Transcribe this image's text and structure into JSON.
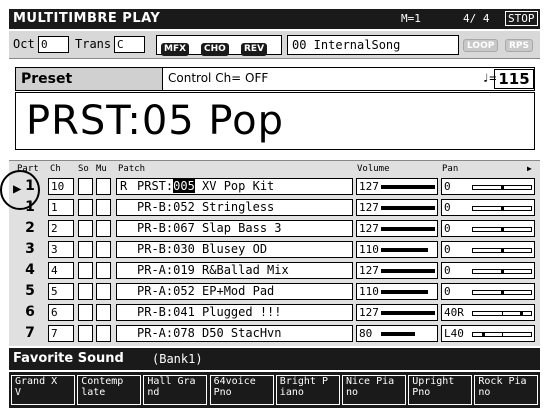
{
  "header": {
    "title": "MULTITIMBRE PLAY",
    "mode": "M=1",
    "meter": "4/ 4",
    "stop_label": "STOP"
  },
  "controls": {
    "oct_label": "Oct",
    "oct_value": "0",
    "trans_label": "Trans",
    "trans_value": "C",
    "mfx_label": "MFX",
    "cho_label": "CHO",
    "rev_label": "REV",
    "song": "00  InternalSong",
    "loop_label": "LOOP",
    "rps_label": "RPS"
  },
  "preset": {
    "label": "Preset",
    "control_ch": "Control Ch= OFF",
    "tempo_symbol": "♩=",
    "tempo": "115",
    "patch_name": "PRST:05 Pop"
  },
  "table": {
    "col_part": "Part",
    "col_ch": "Ch",
    "col_so": "So",
    "col_mu": "Mu",
    "col_patch": "Patch",
    "col_volume": "Volume",
    "col_pan": "Pan",
    "rows": [
      {
        "part": "1",
        "ch": "10",
        "rflag": "R",
        "patch_pre": "PRST:",
        "patch_sel": "005",
        "patch_post": " XV Pop Kit",
        "volume": "127",
        "volume_level": 1.0,
        "pan": "0",
        "pan_pos": 0.5
      },
      {
        "part": "1",
        "ch": "1",
        "rflag": "",
        "patch_pre": "PR-B:052 Stringless",
        "patch_sel": "",
        "patch_post": "",
        "volume": "127",
        "volume_level": 1.0,
        "pan": "0",
        "pan_pos": 0.5
      },
      {
        "part": "2",
        "ch": "2",
        "rflag": "",
        "patch_pre": "PR-B:067 Slap Bass 3",
        "patch_sel": "",
        "patch_post": "",
        "volume": "127",
        "volume_level": 1.0,
        "pan": "0",
        "pan_pos": 0.5
      },
      {
        "part": "3",
        "ch": "3",
        "rflag": "",
        "patch_pre": "PR-B:030 Blusey OD",
        "patch_sel": "",
        "patch_post": "",
        "volume": "110",
        "volume_level": 0.87,
        "pan": "0",
        "pan_pos": 0.5
      },
      {
        "part": "4",
        "ch": "4",
        "rflag": "",
        "patch_pre": "PR-A:019 R&Ballad Mix",
        "patch_sel": "",
        "patch_post": "",
        "volume": "127",
        "volume_level": 1.0,
        "pan": "0",
        "pan_pos": 0.5
      },
      {
        "part": "5",
        "ch": "5",
        "rflag": "",
        "patch_pre": "PR-A:052 EP+Mod Pad",
        "patch_sel": "",
        "patch_post": "",
        "volume": "110",
        "volume_level": 0.87,
        "pan": "0",
        "pan_pos": 0.5
      },
      {
        "part": "6",
        "ch": "6",
        "rflag": "",
        "patch_pre": "PR-B:041 Plugged !!!",
        "patch_sel": "",
        "patch_post": "",
        "volume": "127",
        "volume_level": 1.0,
        "pan": "40R",
        "pan_pos": 0.82
      },
      {
        "part": "7",
        "ch": "7",
        "rflag": "",
        "patch_pre": "PR-A:078 D50 StacHvn",
        "patch_sel": "",
        "patch_post": "",
        "volume": "80",
        "volume_level": 0.63,
        "pan": "L40",
        "pan_pos": 0.18
      }
    ]
  },
  "favorite": {
    "title": "Favorite Sound",
    "bank": "(Bank1)",
    "keys": [
      "Grand X\nV",
      "Contemp\nlate",
      "Hall Gra\nnd",
      "64voice\nPno",
      "Bright P\niano",
      "Nice Pia\nno",
      "Upright\nPno",
      "Rock Pia\nno"
    ]
  }
}
